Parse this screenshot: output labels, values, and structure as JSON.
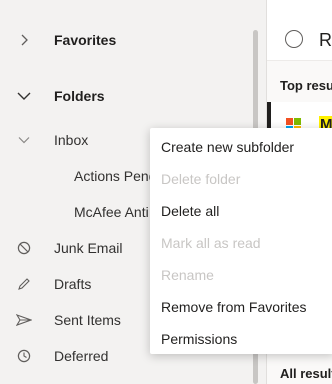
{
  "folder_pane": {
    "favorites": "Favorites",
    "folders": "Folders",
    "inbox": "Inbox",
    "subfolders": [
      "Actions Pend",
      "McAfee Anti"
    ],
    "junk": "Junk Email",
    "drafts": "Drafts",
    "sent": "Sent Items",
    "deferred": "Deferred"
  },
  "reading_pane": {
    "title": "R",
    "top_results": "Top resu",
    "highlight_text": "M",
    "all_results": "All result"
  },
  "context_menu": {
    "items": [
      {
        "label": "Create new subfolder",
        "enabled": true
      },
      {
        "label": "Delete folder",
        "enabled": false
      },
      {
        "label": "Delete all",
        "enabled": true
      },
      {
        "label": "Mark all as read",
        "enabled": false
      },
      {
        "label": "Rename",
        "enabled": false
      },
      {
        "label": "Remove from Favorites",
        "enabled": true
      },
      {
        "label": "Permissions",
        "enabled": true
      }
    ]
  },
  "colors": {
    "pane_bg": "#f3f2f1",
    "disabled_text": "#c8c6c4",
    "accent": "#0078d4"
  },
  "icons": {
    "favorites": "chevron-right-icon",
    "folders": "chevron-down-icon",
    "inbox": "chevron-down-icon",
    "junk": "blocked-icon",
    "drafts": "pencil-icon",
    "sent": "send-icon",
    "deferred": "clock-icon"
  }
}
